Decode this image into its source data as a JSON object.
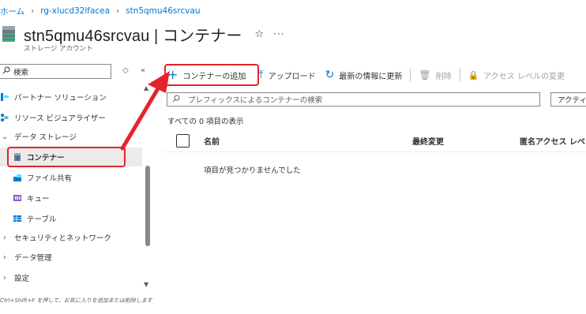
{
  "breadcrumb": [
    "ホーム",
    "rg-xlucd32lfacea",
    "stn5qmu46srcvau"
  ],
  "header": {
    "title": "stn5qmu46srcvau | コンテナー",
    "subtitle": "ストレージ アカウント"
  },
  "sidebar": {
    "search_placeholder": "検索",
    "items": [
      {
        "label": "パートナー ソリューション",
        "icon": "partner-icon"
      },
      {
        "label": "リソース ビジュアライザー",
        "icon": "visualizer-icon"
      },
      {
        "label": "データ ストレージ",
        "icon": "chevron-down-icon"
      },
      {
        "label": "コンテナー",
        "icon": "container-icon"
      },
      {
        "label": "ファイル共有",
        "icon": "file-share-icon"
      },
      {
        "label": "キュー",
        "icon": "queue-icon"
      },
      {
        "label": "テーブル",
        "icon": "table-icon"
      },
      {
        "label": "セキュリティとネットワーク",
        "icon": "chevron-right-icon"
      },
      {
        "label": "データ管理",
        "icon": "chevron-right-icon"
      },
      {
        "label": "設定",
        "icon": "chevron-right-icon"
      }
    ],
    "shortcut_note": "Ctrl+Shift+F を押して、お気に入りを追加または削除します"
  },
  "toolbar": {
    "add_container": "コンテナーの追加",
    "upload": "アップロード",
    "refresh": "最新の情報に更新",
    "delete": "削除",
    "change_access": "アクセス レベルの変更"
  },
  "filter": {
    "placeholder": "プレフィックスによるコンテナーの検索",
    "scope": "アクティ"
  },
  "list": {
    "count_text": "すべての 0 項目の表示",
    "columns": [
      "名前",
      "最終変更",
      "匿名アクセス レベ"
    ],
    "empty_text": "項目が見つかりませんでした"
  },
  "colors": {
    "accent": "#0078d4",
    "annotation": "#e5232b",
    "selected_bg": "#edebe9"
  }
}
